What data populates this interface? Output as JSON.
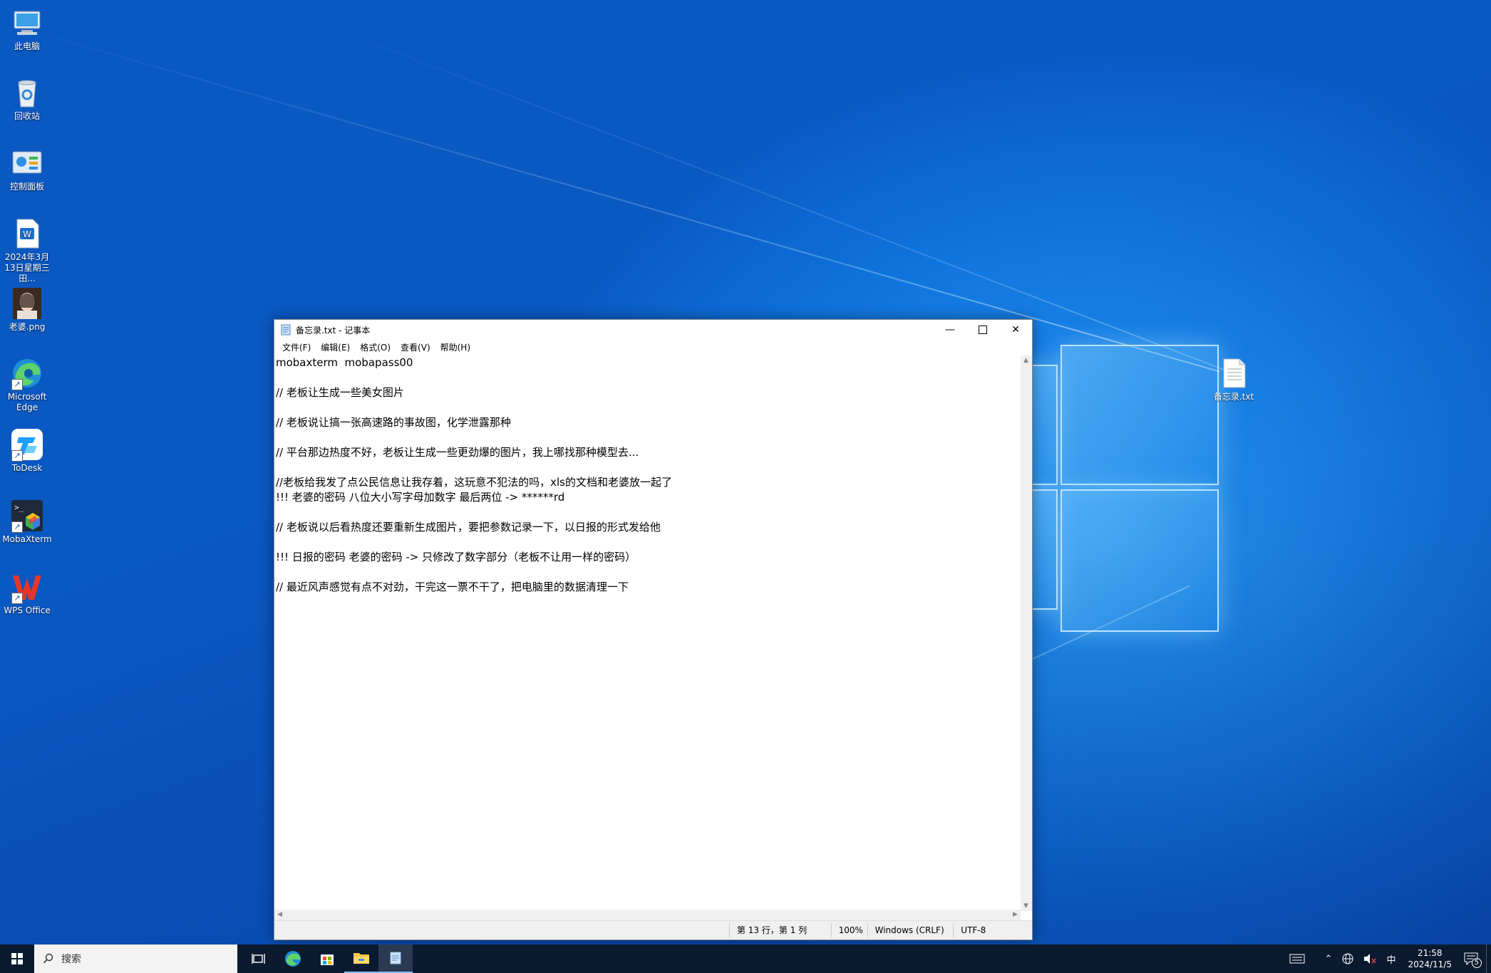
{
  "desktop": {
    "icons": [
      {
        "label": "此电脑",
        "icon": "computer-icon"
      },
      {
        "label": "回收站",
        "icon": "recycle-bin-icon"
      },
      {
        "label": "控制面板",
        "icon": "control-panel-icon"
      },
      {
        "label": "2024年3月13日星期三 田...",
        "icon": "word-document-icon"
      },
      {
        "label": "老婆.png",
        "icon": "image-file-icon"
      },
      {
        "label": "Microsoft Edge",
        "icon": "edge-icon"
      },
      {
        "label": "ToDesk",
        "icon": "todesk-icon"
      },
      {
        "label": "MobaXterm",
        "icon": "mobaxterm-icon"
      },
      {
        "label": "WPS Office",
        "icon": "wps-office-icon"
      }
    ],
    "right_icon": {
      "label": "备忘录.txt",
      "icon": "text-file-icon"
    }
  },
  "notepad": {
    "title": "备忘录.txt - 记事本",
    "menu": [
      "文件(F)",
      "编辑(E)",
      "格式(O)",
      "查看(V)",
      "帮助(H)"
    ],
    "lines": [
      "mobaxterm  mobapass00",
      "",
      "// 老板让生成一些美女图片",
      "",
      "// 老板说让搞一张高速路的事故图，化学泄露那种",
      "",
      "// 平台那边热度不好，老板让生成一些更劲爆的图片，我上哪找那种模型去...",
      "",
      "//老板给我发了点公民信息让我存着，这玩意不犯法的吗，xls的文档和老婆放一起了",
      "!!! 老婆的密码 八位大小写字母加数字 最后两位 -> ******rd",
      "",
      "// 老板说以后看热度还要重新生成图片，要把参数记录一下，以日报的形式发给他",
      "",
      "!!! 日报的密码 老婆的密码 -> 只修改了数字部分（老板不让用一样的密码）",
      "",
      "// 最近风声感觉有点不对劲，干完这一票不干了，把电脑里的数据清理一下"
    ],
    "status": {
      "position": "第 13 行，第 1 列",
      "zoom": "100%",
      "line_ending": "Windows (CRLF)",
      "encoding": "UTF-8"
    }
  },
  "taskbar": {
    "search_placeholder": "搜索",
    "apps": [
      "task-view-icon",
      "edge-icon",
      "store-icon",
      "file-explorer-icon",
      "notepad-icon"
    ],
    "tray": {
      "ime": "中",
      "time": "21:58",
      "date": "2024/11/5",
      "notification_count": "5"
    }
  }
}
